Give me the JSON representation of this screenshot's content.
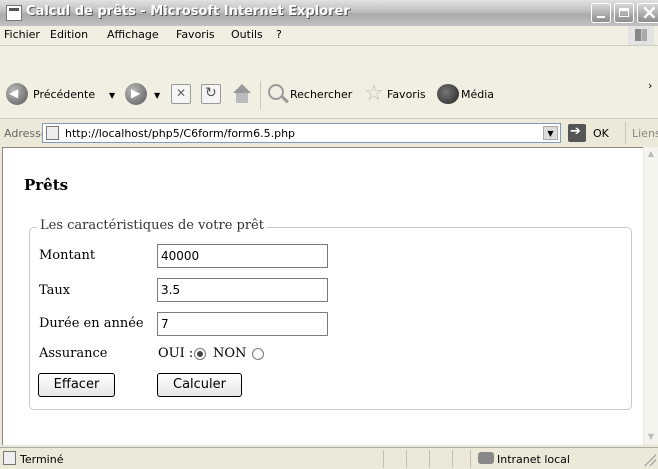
{
  "window": {
    "title": "Calcul de prêts - Microsoft Internet Explorer"
  },
  "menu": {
    "items": [
      "Fichier",
      "Edition",
      "Affichage",
      "Favoris",
      "Outils",
      "?"
    ]
  },
  "toolbar": {
    "back_label": "Précédente",
    "search_label": "Rechercher",
    "favorites_label": "Favoris",
    "media_label": "Média",
    "more": "›"
  },
  "address": {
    "label": "Adresse",
    "url": "http://localhost/php5/C6form/form6.5.php",
    "go_label": "OK",
    "links_label": "Liens"
  },
  "page": {
    "title": "Prêts",
    "legend": "Les caractéristiques de votre prêt",
    "fields": {
      "montant": {
        "label": "Montant",
        "value": "40000"
      },
      "taux": {
        "label": "Taux",
        "value": "3.5"
      },
      "duree": {
        "label": "Durée en année",
        "value": "7"
      }
    },
    "assurance": {
      "label": "Assurance",
      "oui_label": "OUI :",
      "non_label": "NON",
      "selected": "OUI"
    },
    "buttons": {
      "reset": "Effacer",
      "submit": "Calculer"
    }
  },
  "status": {
    "text": "Terminé",
    "zone": "Intranet local"
  }
}
